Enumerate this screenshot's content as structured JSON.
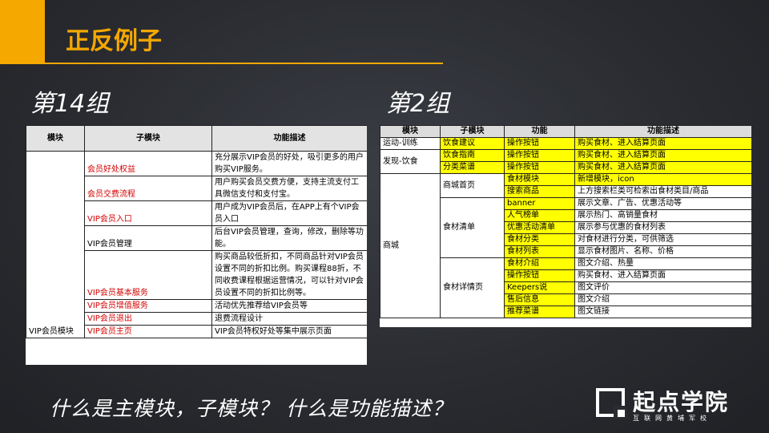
{
  "header": {
    "title": "正反例子",
    "accent_color": "#f5a800"
  },
  "left": {
    "group_title": "第14组",
    "headers": [
      "模块",
      "子模块",
      "功能描述"
    ],
    "module": "VIP会员模块",
    "rows": [
      {
        "sub": "会员好处权益",
        "desc": "充分展示VIP会员的好处，吸引更多的用户购买VIP服务。"
      },
      {
        "sub": "会员交费流程",
        "desc": "用户购买会员交费方便，支持主流支付工具微信支付和支付宝。"
      },
      {
        "sub": "VIP会员入口",
        "desc": "用户成为VIP会员后，在APP上有个VIP会员入口"
      },
      {
        "sub": "VIP会员管理",
        "desc": "后台VIP会员管理，查询，修改，删除等功能。"
      },
      {
        "sub": "VIP会员基本服务",
        "desc": "购买商品较低折扣，不同商品针对VIP会员设置不同的折扣比例。购买课程88折，不同收费课程根据运营情况，可以针对VIP会员设置不同的折扣比例等。"
      },
      {
        "sub": "VIP会员增值服务",
        "desc": "活动优先推荐给VIP会员等"
      },
      {
        "sub": "VIP会员退出",
        "desc": "退费流程设计"
      },
      {
        "sub": "VIP会员主页",
        "desc": "VIP会员特权好处等集中展示页面"
      }
    ]
  },
  "right": {
    "group_title": "第2组",
    "headers": [
      "模块",
      "子模块",
      "功能",
      "功能描述"
    ],
    "modules": [
      "运动-训练",
      "发现-饮食",
      "商城"
    ],
    "submodules": [
      "饮食建议",
      "饮食指南",
      "分类菜谱",
      "商城首页",
      "食材清单",
      "食材详情页"
    ],
    "rows": [
      {
        "func": "操作按钮",
        "desc": "购买食材、进入结算页面"
      },
      {
        "func": "操作按钮",
        "desc": "购买食材、进入结算页面"
      },
      {
        "func": "操作按钮",
        "desc": "购买食材、进入结算页面"
      },
      {
        "func": "食材模块",
        "desc": "新增模块，icon"
      },
      {
        "func": "搜索商品",
        "desc": "上方搜索栏类可检索出食材类目/商品"
      },
      {
        "func": "banner",
        "desc": "展示文章、广告、优惠活动等"
      },
      {
        "func": "人气榜单",
        "desc": "展示热门、高销量食材"
      },
      {
        "func": "优惠活动清单",
        "desc": "展示参与优惠的食材列表"
      },
      {
        "func": "食材分类",
        "desc": "对食材进行分类，可供筛选"
      },
      {
        "func": "食材列表",
        "desc": "显示食材图片、名称、价格"
      },
      {
        "func": "食材介绍",
        "desc": "图文介绍、热量"
      },
      {
        "func": "操作按钮",
        "desc": "购买食材、进入结算页面"
      },
      {
        "func": "Keepers说",
        "desc": "图文评价"
      },
      {
        "func": "售后信息",
        "desc": "图文介绍"
      },
      {
        "func": "推荐菜谱",
        "desc": "图文链接"
      }
    ]
  },
  "question": "什么是主模块，子模块？   什么是功能描述？",
  "logo": {
    "name": "起点学院",
    "sub": "互联网黄埔军校"
  }
}
